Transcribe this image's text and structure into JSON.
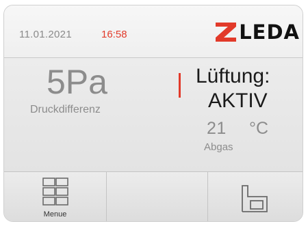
{
  "header": {
    "date": "11.01.2021",
    "time": "16:58",
    "logo_text": "LEDA"
  },
  "main": {
    "pressure_value": "5Pa",
    "pressure_label": "Druckdifferenz",
    "ventilation_title": "Lüftung:",
    "ventilation_status": "AKTIV",
    "temperature_value": "21",
    "temperature_unit": "°C",
    "temperature_label": "Abgas"
  },
  "footer": {
    "menu_label": "Menue"
  },
  "colors": {
    "accent_red": "#e23a2a",
    "text_dark": "#1a1a1a",
    "text_grey": "#8c8c8c"
  },
  "icons": [
    "leda-logo-mark",
    "menu-grid-icon",
    "house-settings-icon"
  ]
}
